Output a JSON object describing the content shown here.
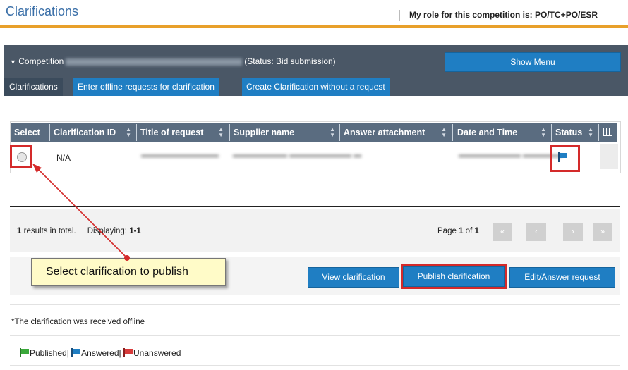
{
  "header": {
    "title": "Clarifications",
    "role_text": "My role for this competition is: PO/TC+PO/ESR"
  },
  "competition": {
    "prefix": "Competition",
    "status": "(Status: Bid submission)",
    "show_menu_label": "Show Menu"
  },
  "tabs": [
    {
      "label": "Clarifications"
    },
    {
      "label": "Enter offline requests for clarification"
    },
    {
      "label": "Create Clarification without a request"
    }
  ],
  "table": {
    "columns": [
      "Select",
      "Clarification ID",
      "Title of request",
      "Supplier name",
      "Answer attachment",
      "Date and Time",
      "Status"
    ],
    "rows": [
      {
        "clarification_id": "N/A",
        "status_icon": "flag-blue-icon"
      }
    ]
  },
  "pager": {
    "results_count": "1",
    "results_label": "results in total.",
    "displaying_label": "Displaying:",
    "displaying_range": "1-1",
    "page_label": "Page",
    "page_current": "1",
    "page_of": "of",
    "page_total": "1",
    "buttons": [
      "first-page-icon",
      "prev-page-icon",
      "next-page-icon",
      "last-page-icon"
    ]
  },
  "actions": {
    "view_label": "View clarification",
    "publish_label": "Publish clarification",
    "edit_label": "Edit/Answer request"
  },
  "callout": {
    "text": "Select clarification to publish"
  },
  "footer": {
    "offline_note": "*The clarification was received offline",
    "legend": {
      "published": "Published|",
      "answered": "Answered|",
      "unanswered": "Unanswered"
    }
  },
  "colors": {
    "accent_blue": "#1f7ec3",
    "header_orange": "#e8a02a",
    "highlight_red": "#d42a2a",
    "flag_green": "#3aa83a",
    "flag_blue": "#1f7ec3",
    "flag_red": "#d83a3a"
  }
}
